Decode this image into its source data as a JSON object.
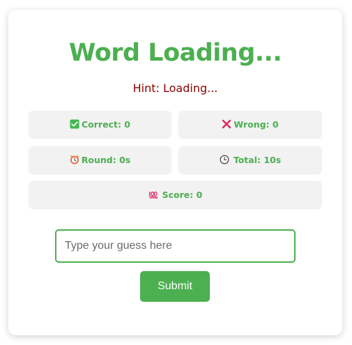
{
  "game": {
    "title": "Word Loading...",
    "hint": "Hint: Loading..."
  },
  "stats": {
    "correct": {
      "icon": "check-box-icon",
      "label": "Correct: 0"
    },
    "wrong": {
      "icon": "cross-mark-icon",
      "label": "Wrong: 0"
    },
    "round": {
      "icon": "alarm-clock-icon",
      "label": "Round: 0s"
    },
    "total": {
      "icon": "clock-icon",
      "label": "Total: 10s"
    },
    "score": {
      "icon": "hundred-points-icon",
      "label": "Score: 0"
    }
  },
  "guess": {
    "placeholder": "Type your guess here",
    "value": ""
  },
  "submit": {
    "label": "Submit"
  },
  "colors": {
    "accent": "#4caf50",
    "hint": "#8b0000",
    "stat_bg": "#f2f2f2"
  }
}
